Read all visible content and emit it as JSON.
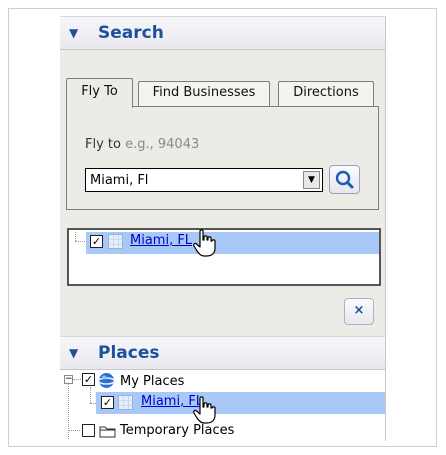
{
  "search": {
    "header": "Search",
    "tabs": [
      "Fly To",
      "Find Businesses",
      "Directions"
    ],
    "fly_label": "Fly to",
    "fly_hint": "e.g., 94043",
    "input_value": "Miami, Fl",
    "result_link": "Miami, FL",
    "close_label": "×"
  },
  "places": {
    "header": "Places",
    "my_places": "My Places",
    "item_link": "Miami, FL",
    "temporary": "Temporary Places"
  },
  "colors": {
    "accent": "#1e4f9c",
    "highlight": "#a8c8f8",
    "panel": "#ecebe5"
  }
}
